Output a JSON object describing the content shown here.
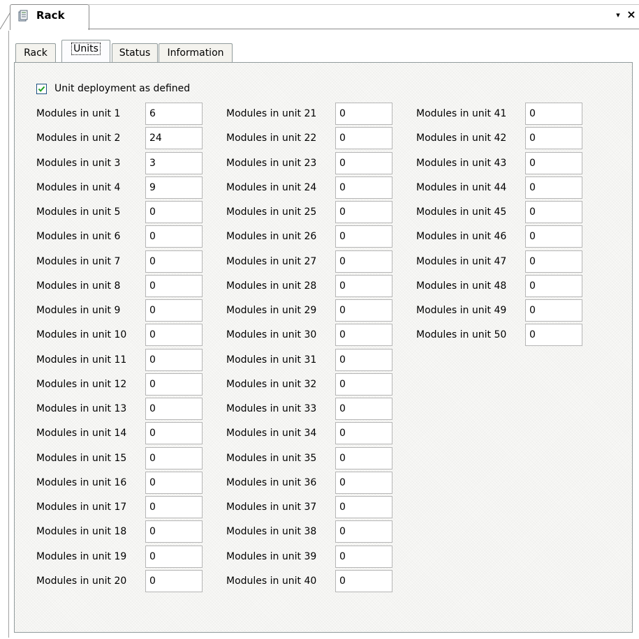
{
  "document": {
    "title": "Rack",
    "icon": "rack-document-icon",
    "pin_glyph": "▾",
    "close_glyph": "×"
  },
  "tabs": [
    {
      "label": "Rack",
      "active": false
    },
    {
      "label": "Units",
      "active": true
    },
    {
      "label": "Status",
      "active": false
    },
    {
      "label": "Information",
      "active": false
    }
  ],
  "deployment": {
    "label": "Unit deployment as defined",
    "checked": true
  },
  "units": [
    {
      "label": "Modules in unit 1",
      "value": "6"
    },
    {
      "label": "Modules in unit 2",
      "value": "24"
    },
    {
      "label": "Modules in unit 3",
      "value": "3"
    },
    {
      "label": "Modules in unit 4",
      "value": "9"
    },
    {
      "label": "Modules in unit 5",
      "value": "0"
    },
    {
      "label": "Modules in unit 6",
      "value": "0"
    },
    {
      "label": "Modules in unit 7",
      "value": "0"
    },
    {
      "label": "Modules in unit 8",
      "value": "0"
    },
    {
      "label": "Modules in unit 9",
      "value": "0"
    },
    {
      "label": "Modules in unit 10",
      "value": "0"
    },
    {
      "label": "Modules in unit 11",
      "value": "0"
    },
    {
      "label": "Modules in unit 12",
      "value": "0"
    },
    {
      "label": "Modules in unit 13",
      "value": "0"
    },
    {
      "label": "Modules in unit 14",
      "value": "0"
    },
    {
      "label": "Modules in unit 15",
      "value": "0"
    },
    {
      "label": "Modules in unit 16",
      "value": "0"
    },
    {
      "label": "Modules in unit 17",
      "value": "0"
    },
    {
      "label": "Modules in unit 18",
      "value": "0"
    },
    {
      "label": "Modules in unit 19",
      "value": "0"
    },
    {
      "label": "Modules in unit 20",
      "value": "0"
    },
    {
      "label": "Modules in unit 21",
      "value": "0"
    },
    {
      "label": "Modules in unit 22",
      "value": "0"
    },
    {
      "label": "Modules in unit 23",
      "value": "0"
    },
    {
      "label": "Modules in unit 24",
      "value": "0"
    },
    {
      "label": "Modules in unit 25",
      "value": "0"
    },
    {
      "label": "Modules in unit 26",
      "value": "0"
    },
    {
      "label": "Modules in unit 27",
      "value": "0"
    },
    {
      "label": "Modules in unit 28",
      "value": "0"
    },
    {
      "label": "Modules in unit 29",
      "value": "0"
    },
    {
      "label": "Modules in unit 30",
      "value": "0"
    },
    {
      "label": "Modules in unit 31",
      "value": "0"
    },
    {
      "label": "Modules in unit 32",
      "value": "0"
    },
    {
      "label": "Modules in unit 33",
      "value": "0"
    },
    {
      "label": "Modules in unit 34",
      "value": "0"
    },
    {
      "label": "Modules in unit 35",
      "value": "0"
    },
    {
      "label": "Modules in unit 36",
      "value": "0"
    },
    {
      "label": "Modules in unit 37",
      "value": "0"
    },
    {
      "label": "Modules in unit 38",
      "value": "0"
    },
    {
      "label": "Modules in unit 39",
      "value": "0"
    },
    {
      "label": "Modules in unit 40",
      "value": "0"
    },
    {
      "label": "Modules in unit 41",
      "value": "0"
    },
    {
      "label": "Modules in unit 42",
      "value": "0"
    },
    {
      "label": "Modules in unit 43",
      "value": "0"
    },
    {
      "label": "Modules in unit 44",
      "value": "0"
    },
    {
      "label": "Modules in unit 45",
      "value": "0"
    },
    {
      "label": "Modules in unit 46",
      "value": "0"
    },
    {
      "label": "Modules in unit 47",
      "value": "0"
    },
    {
      "label": "Modules in unit 48",
      "value": "0"
    },
    {
      "label": "Modules in unit 49",
      "value": "0"
    },
    {
      "label": "Modules in unit 50",
      "value": "0"
    }
  ]
}
